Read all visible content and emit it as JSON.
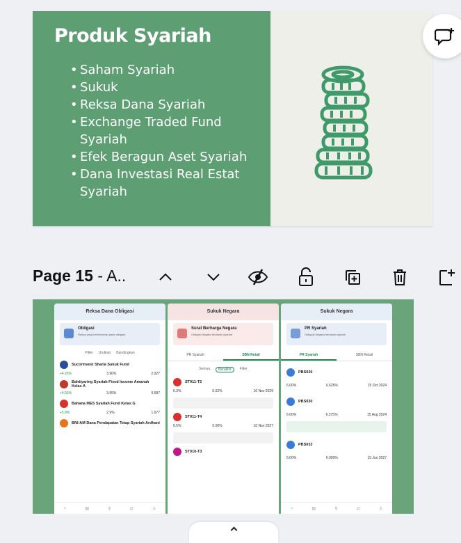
{
  "slide14": {
    "title": "Produk Syariah",
    "bullets": [
      "Saham Syariah",
      "Sukuk",
      "Reksa Dana Syariah",
      "Exchange Traded Fund Syariah",
      "Efek Beragun Aset Syariah",
      "Dana Investasi Real Estat Syariah"
    ],
    "colors": {
      "green": "#5e9e73",
      "coin_green": "#3f9a6a",
      "bg": "#efefe9"
    }
  },
  "comment_icon": "comment-add-icon",
  "page_toolbar": {
    "page_label": "Page 15",
    "page_sep": " - A.."
  },
  "page15": {
    "phones": [
      {
        "header": "Reksa Dana Obligasi",
        "hero_title": "Obligasi",
        "hero_sub": "Reksa yang berinvestasi pada obligasi",
        "filters": [
          "Pilter",
          "Urutkan",
          "Bandingkan"
        ],
        "items": [
          {
            "name": "Sucorinvest Sharia Sukuk Fund",
            "vals": [
              "+4.26%",
              "3.90%",
              "2,027"
            ]
          },
          {
            "name": "Bahtiyaring Syariah Fixed Income Amanah Kelas A",
            "vals": [
              "+4.56%",
              "3.95%",
              "0.687"
            ]
          },
          {
            "name": "Bahana MES Syariah Fund Kelas G",
            "vals": [
              "+5.8%",
              "2.9%",
              "1.677"
            ]
          },
          {
            "name": "BNI-AM Dana Pendapatan Tetap Syariah Ardhani",
            "vals": [
              "",
              "",
              ""
            ]
          }
        ]
      },
      {
        "header": "Sukuk Negara",
        "hero_title": "Surat Berharga Negara",
        "hero_sub": "Obligasi Negara berbasis syariah",
        "tabs": [
          "PR Syariah",
          "SBN Retail"
        ],
        "filters": [
          "Semua",
          "Berakhir",
          "Filter"
        ],
        "items": [
          {
            "name": "ST011-T2",
            "vals": [
              "6.3%",
              "0.62%",
              "10 Nov 2029"
            ]
          },
          {
            "name": "ST011-T4",
            "vals": [
              "6.5%",
              "0.00%",
              "10 Nov 2027"
            ]
          },
          {
            "name": "ST010-T3",
            "vals": [
              "",
              "",
              ""
            ]
          }
        ]
      },
      {
        "header": "Sukuk Negara",
        "hero_title": "PR Syariah",
        "hero_sub": "Obligasi Negara berbasis syariah",
        "tabs": [
          "PR Syariah",
          "SBN Retail"
        ],
        "items": [
          {
            "name": "PBS026",
            "vals": [
              "6.00%",
              "6.625%",
              "15 Oct 2024"
            ]
          },
          {
            "name": "PBS030",
            "vals": [
              "6.00%",
              "6.375%",
              "15 Aug 2024"
            ]
          },
          {
            "name": "PBS033",
            "vals": [
              "6.00%",
              "6.000%",
              "15 Jun 2027"
            ]
          }
        ]
      }
    ]
  }
}
